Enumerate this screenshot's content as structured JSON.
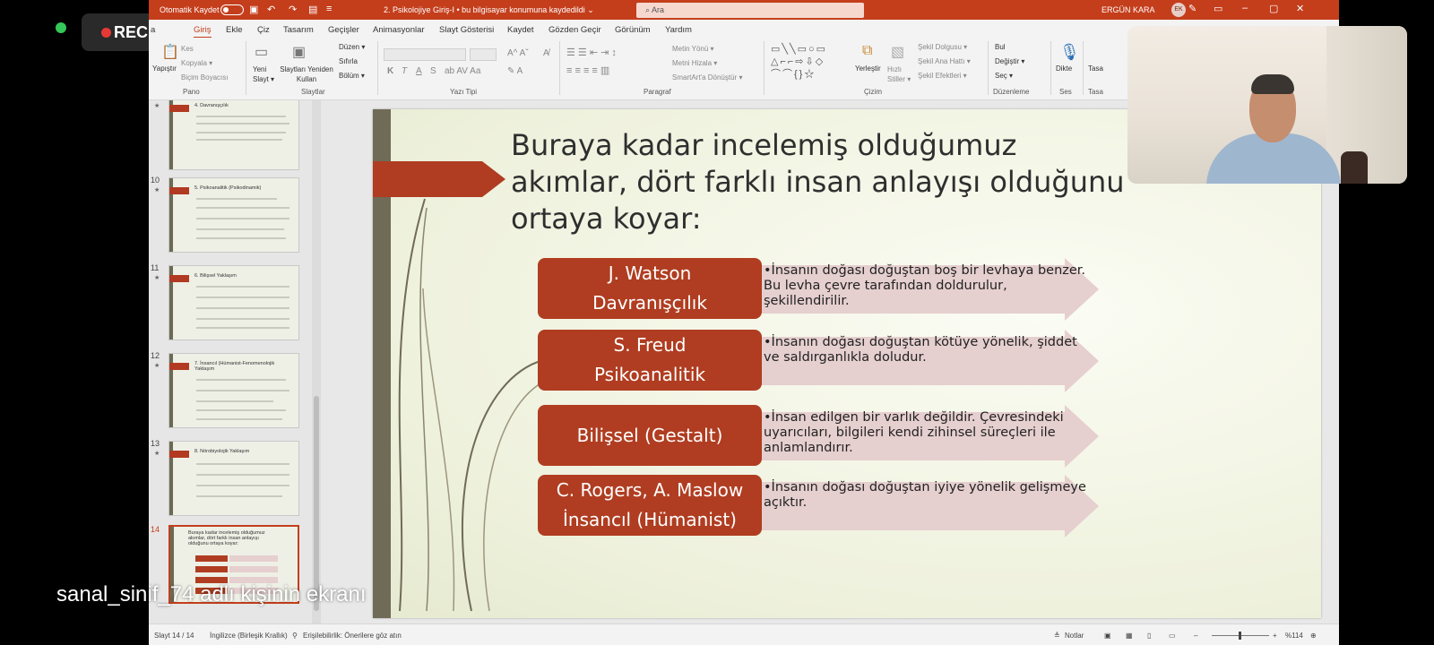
{
  "recording": {
    "label": "REC"
  },
  "titlebar": {
    "autosave_label": "Otomatik Kaydet",
    "doc_title": "2. Psikolojiye Giriş-I  •  bu bilgisayar konumuna kaydedildi  ⌄",
    "search_placeholder": "Ara",
    "user_name": "ERGÜN KARA",
    "user_initials": "EK"
  },
  "ribbon_tabs": [
    "a",
    "Giriş",
    "Ekle",
    "Çiz",
    "Tasarım",
    "Geçişler",
    "Animasyonlar",
    "Slayt Gösterisi",
    "Kaydet",
    "Gözden Geçir",
    "Görünüm",
    "Yardım"
  ],
  "ribbon": {
    "pano": {
      "paste": "Yapıştır",
      "cut": "Kes",
      "copy": "Kopyala ▾",
      "format_painter": "Biçim Boyacısı",
      "label": "Pano"
    },
    "slaytlar": {
      "new_slide": "Yeni Slayt ▾",
      "reuse": "Slaytları Yeniden Kullan",
      "layout": "Düzen ▾",
      "reset": "Sıfırla",
      "section": "Bölüm ▾",
      "label": "Slaytlar"
    },
    "yazi_tipi": {
      "label": "Yazı Tipi",
      "bold": "K",
      "italic": "T",
      "underline": "A",
      "strike": "S"
    },
    "paragraf": {
      "label": "Paragraf",
      "text_direction": "Metin Yönü ▾",
      "align_text": "Metni Hizala ▾",
      "smartart": "SmartArt'a Dönüştür ▾"
    },
    "cizim": {
      "label": "Çizim",
      "arrange": "Yerleştir",
      "quick_styles": "Hızlı Stiller ▾",
      "shape_fill": "Şekil Dolgusu ▾",
      "shape_outline": "Şekil Ana Hattı ▾",
      "shape_effects": "Şekil Efektleri ▾"
    },
    "duzenleme": {
      "label": "Düzenleme",
      "find": "Bul",
      "replace": "Değiştir ▾",
      "select": "Seç ▾"
    },
    "ses": {
      "label": "Ses",
      "dictate": "Dikte"
    },
    "tasarimci": {
      "label": "Tasa",
      "button": "Tasa"
    }
  },
  "thumbnails": [
    {
      "num": "",
      "title": "4. Davranışçılık"
    },
    {
      "num": "10",
      "title": "5. Psikoanalitik (Psikodinamik)"
    },
    {
      "num": "11",
      "title": "6. Bilişsel Yaklaşım"
    },
    {
      "num": "12",
      "title": "7. İnsancıl (Hümanist-Fenomenolojik Yaklaşım"
    },
    {
      "num": "13",
      "title": "8. Nörobiyolojik Yaklaşım"
    },
    {
      "num": "14",
      "title": "Buraya kadar incelemiş olduğumuz akımlar, dört farklı insan anlayışı olduğunu ortaya koyar:"
    }
  ],
  "slide": {
    "title": "Buraya kadar incelemiş olduğumuz akımlar, dört farklı insan anlayışı olduğunu ortaya koyar:",
    "rows": [
      {
        "line1": "J. Watson",
        "line2": "Davranışçılık",
        "desc": "•İnsanın doğası doğuştan boş bir levhaya benzer. Bu levha çevre tarafından doldurulur, şekillendirilir."
      },
      {
        "line1": "S. Freud",
        "line2": "Psikoanalitik",
        "desc": "•İnsanın doğası doğuştan kötüye yönelik, şiddet ve saldırganlıkla doludur."
      },
      {
        "line1": "Bilişsel (Gestalt)",
        "line2": "",
        "desc": "•İnsan edilgen bir varlık değildir. Çevresindeki uyarıcıları, bilgileri kendi zihinsel süreçleri ile anlamlandırır."
      },
      {
        "line1": "C. Rogers, A. Maslow",
        "line2": "İnsancıl (Hümanist)",
        "desc": "•İnsanın doğası doğuştan iyiye yönelik gelişmeye açıktır."
      }
    ]
  },
  "statusbar": {
    "slide_count": "Slayt 14 / 14",
    "language": "İngilizce (Birleşik Krallık)",
    "accessibility": "Erişilebilirlik: Önerilere göz atın",
    "notes": "Notlar",
    "zoom": "%114"
  },
  "caption": "sanal_sinif_74 adlı kişinin ekranı",
  "colors": {
    "accent": "#c43e1c",
    "label_fill": "#b03d21",
    "arrow_fill": "#e6cfcf"
  }
}
